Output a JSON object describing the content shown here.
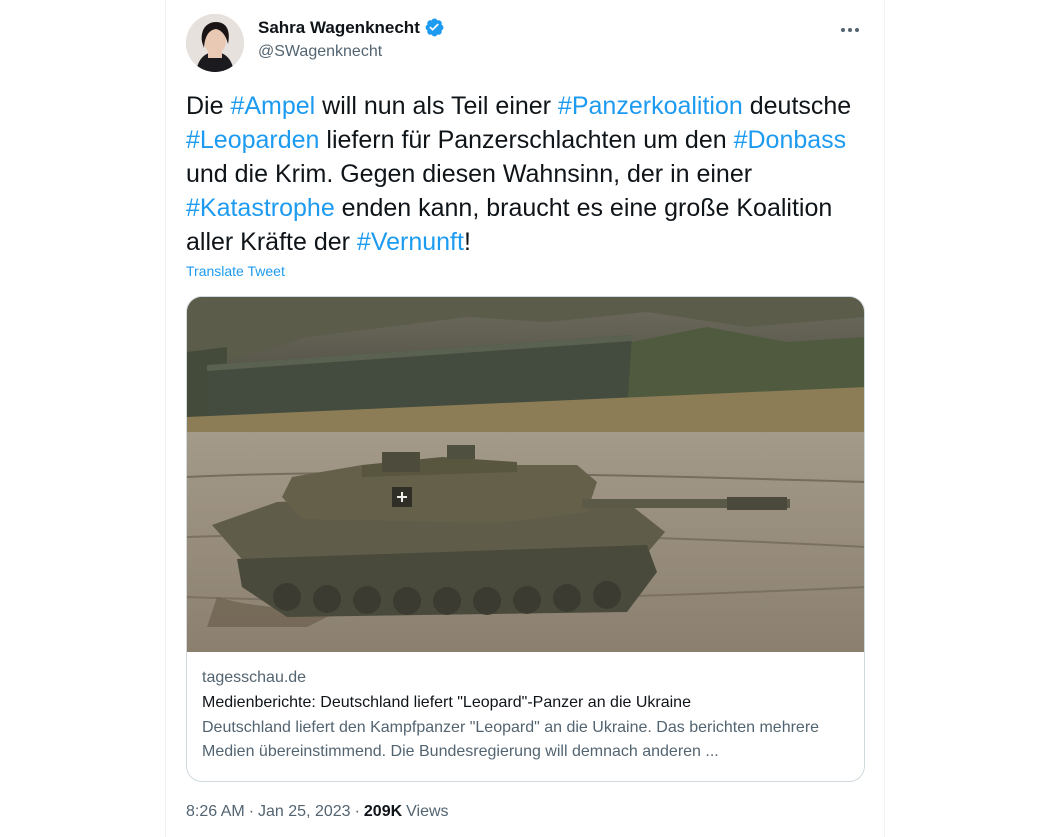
{
  "author": {
    "display_name": "Sahra Wagenknecht",
    "handle": "@SWagenknecht",
    "verified": true
  },
  "tweet": {
    "segments": [
      {
        "text": "Die ",
        "hashtag": false
      },
      {
        "text": "#Ampel",
        "hashtag": true
      },
      {
        "text": " will nun als Teil einer ",
        "hashtag": false
      },
      {
        "text": "#Panzerkoalition",
        "hashtag": true
      },
      {
        "text": " deutsche ",
        "hashtag": false
      },
      {
        "text": "#Leoparden",
        "hashtag": true
      },
      {
        "text": " liefern für Panzerschlachten um den ",
        "hashtag": false
      },
      {
        "text": "#Donbass",
        "hashtag": true
      },
      {
        "text": " und die Krim. Gegen diesen Wahnsinn, der in einer ",
        "hashtag": false
      },
      {
        "text": "#Katastrophe",
        "hashtag": true
      },
      {
        "text": " enden kann, braucht es eine große Koalition aller Kräfte der ",
        "hashtag": false
      },
      {
        "text": "#Vernunft",
        "hashtag": true
      },
      {
        "text": "!",
        "hashtag": false
      }
    ],
    "translate_label": "Translate Tweet"
  },
  "card": {
    "domain": "tagesschau.de",
    "title": "Medienberichte: Deutschland liefert \"Leopard\"-Panzer an die Ukraine",
    "description": "Deutschland liefert den Kampfpanzer \"Leopard\" an die Ukraine. Das berichten mehrere Medien übereinstimmend. Die Bundesregierung will demnach anderen ..."
  },
  "meta": {
    "time": "8:26 AM",
    "separator1": "·",
    "date": "Jan 25, 2023",
    "separator2": "·",
    "views_count": "209K",
    "views_label": "Views"
  },
  "icons": {
    "verified": "verified-badge-icon",
    "more": "more-options-icon"
  },
  "colors": {
    "link": "#1d9bf0",
    "text": "#0f1419",
    "secondary": "#536471",
    "border": "#cfd9de"
  }
}
